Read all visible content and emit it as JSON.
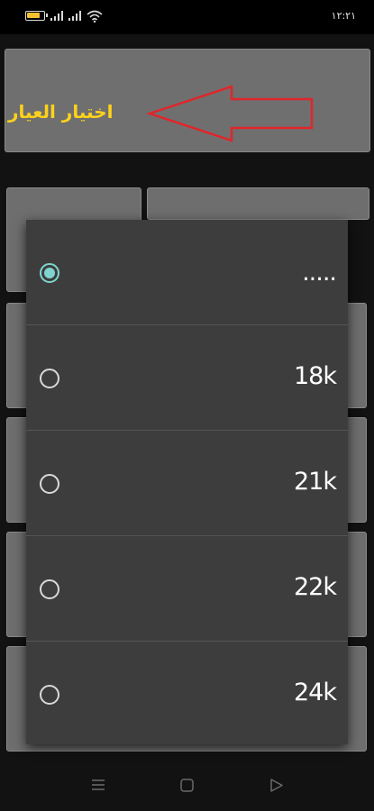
{
  "status_bar": {
    "time": "١٢:٢١",
    "battery_color": "#f2c230",
    "icons": [
      "battery-icon",
      "signal-icon",
      "signal-icon",
      "wifi-icon"
    ]
  },
  "annotation": {
    "text": "اختيار العيار",
    "text_color": "#ffd21a",
    "arrow_color": "#e0262a"
  },
  "dialog": {
    "accent": "#7fd4d0",
    "selected_index": 0,
    "options": [
      {
        "label": "....."
      },
      {
        "label": "18k"
      },
      {
        "label": "21k"
      },
      {
        "label": "22k"
      },
      {
        "label": "24k"
      }
    ]
  },
  "nav_bar": {
    "icons": [
      "menu-icon",
      "home-icon",
      "back-icon"
    ]
  }
}
